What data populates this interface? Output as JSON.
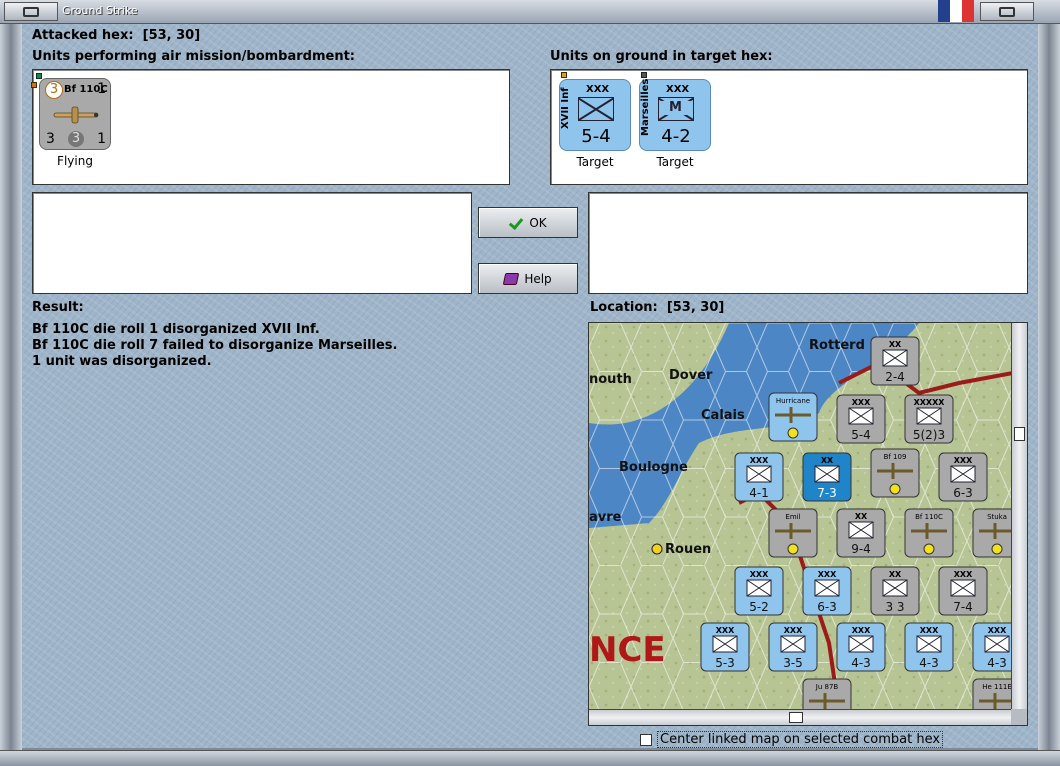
{
  "window": {
    "title": "Ground Strike"
  },
  "attacked_hex": {
    "label": "Attacked hex:",
    "value": "[53, 30]"
  },
  "air_units": {
    "header": "Units performing air mission/bombardment:",
    "units": [
      {
        "name": "Bf 110C",
        "top_left": "3",
        "top_right": "1",
        "bottom_left": "3",
        "bottom_center": "3",
        "bottom_right": "1",
        "status": "Flying"
      }
    ]
  },
  "ground_units": {
    "header": "Units on ground in target hex:",
    "units": [
      {
        "side_name": "XVII Inf",
        "size": "XXX",
        "strength": "5-4",
        "status": "Target"
      },
      {
        "side_name": "Marseilles",
        "size": "XXX",
        "type_letter": "M",
        "strength": "4-2",
        "status": "Target"
      }
    ]
  },
  "buttons": {
    "ok": "OK",
    "help": "Help"
  },
  "result": {
    "label": "Result:",
    "lines": [
      "Bf 110C die roll 1 disorganized XVII Inf.",
      "Bf 110C die roll 7 failed to disorganize Marseilles.",
      "1 unit was disorganized."
    ]
  },
  "location": {
    "label": "Location:",
    "value": "[53, 30]"
  },
  "map": {
    "place_labels": [
      "Rotterd",
      "Dover",
      "nouth",
      "Calais",
      "Boulogne",
      "avre",
      "Rouen",
      "NCE"
    ],
    "counters": [
      {
        "top": "XX",
        "value": "2-4"
      },
      {
        "top": "XXX",
        "value": "5-4"
      },
      {
        "top": "XXXXX",
        "value": "5(2)3"
      },
      {
        "top": "XXX",
        "value": "4-1"
      },
      {
        "top": "XX",
        "value": "7-3"
      },
      {
        "top": "XXX",
        "value": "6-3"
      },
      {
        "top": "XX",
        "value": "9-4"
      },
      {
        "top": "XXX",
        "value": "5-2"
      },
      {
        "top": "XXX",
        "value": "6-3"
      },
      {
        "top": "XX",
        "value": "3 3"
      },
      {
        "top": "XXX",
        "value": "7-4"
      },
      {
        "top": "XXX",
        "value": "5-3"
      },
      {
        "top": "XXX",
        "value": "3-5"
      },
      {
        "top": "XXX",
        "value": "4-3"
      },
      {
        "top": "XXX",
        "value": "4-3"
      },
      {
        "top": "XXX",
        "value": "4-3"
      }
    ],
    "air_labels": [
      "Hurricane",
      "Bf 109",
      "Emil",
      "Bf 110C",
      "Stuka",
      "Ju 87B",
      "He 111E"
    ]
  },
  "center_option": {
    "label": "Center linked map on selected combat hex",
    "checked": false
  }
}
